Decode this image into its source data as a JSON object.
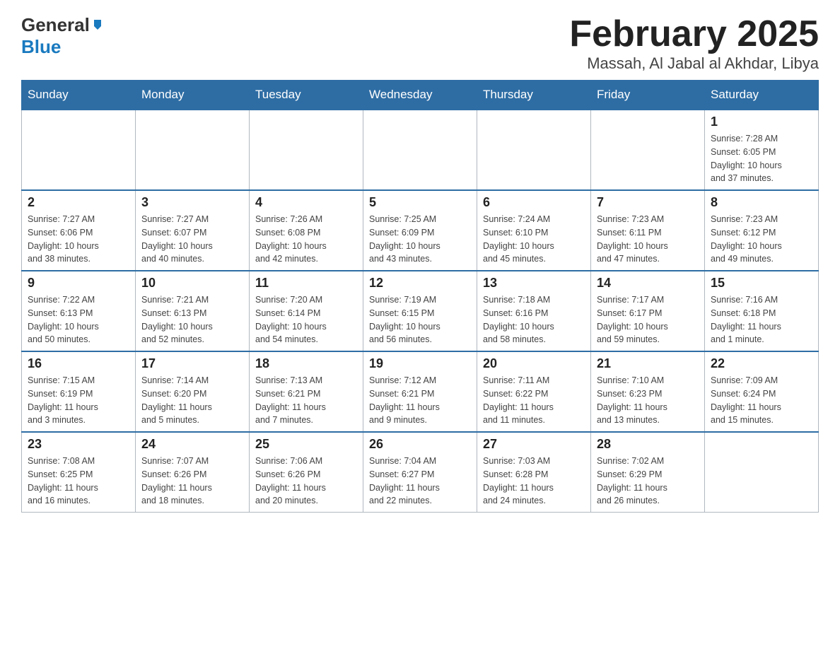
{
  "logo": {
    "general": "General",
    "blue": "Blue"
  },
  "title": "February 2025",
  "subtitle": "Massah, Al Jabal al Akhdar, Libya",
  "weekdays": [
    "Sunday",
    "Monday",
    "Tuesday",
    "Wednesday",
    "Thursday",
    "Friday",
    "Saturday"
  ],
  "weeks": [
    [
      {
        "day": "",
        "info": ""
      },
      {
        "day": "",
        "info": ""
      },
      {
        "day": "",
        "info": ""
      },
      {
        "day": "",
        "info": ""
      },
      {
        "day": "",
        "info": ""
      },
      {
        "day": "",
        "info": ""
      },
      {
        "day": "1",
        "info": "Sunrise: 7:28 AM\nSunset: 6:05 PM\nDaylight: 10 hours\nand 37 minutes."
      }
    ],
    [
      {
        "day": "2",
        "info": "Sunrise: 7:27 AM\nSunset: 6:06 PM\nDaylight: 10 hours\nand 38 minutes."
      },
      {
        "day": "3",
        "info": "Sunrise: 7:27 AM\nSunset: 6:07 PM\nDaylight: 10 hours\nand 40 minutes."
      },
      {
        "day": "4",
        "info": "Sunrise: 7:26 AM\nSunset: 6:08 PM\nDaylight: 10 hours\nand 42 minutes."
      },
      {
        "day": "5",
        "info": "Sunrise: 7:25 AM\nSunset: 6:09 PM\nDaylight: 10 hours\nand 43 minutes."
      },
      {
        "day": "6",
        "info": "Sunrise: 7:24 AM\nSunset: 6:10 PM\nDaylight: 10 hours\nand 45 minutes."
      },
      {
        "day": "7",
        "info": "Sunrise: 7:23 AM\nSunset: 6:11 PM\nDaylight: 10 hours\nand 47 minutes."
      },
      {
        "day": "8",
        "info": "Sunrise: 7:23 AM\nSunset: 6:12 PM\nDaylight: 10 hours\nand 49 minutes."
      }
    ],
    [
      {
        "day": "9",
        "info": "Sunrise: 7:22 AM\nSunset: 6:13 PM\nDaylight: 10 hours\nand 50 minutes."
      },
      {
        "day": "10",
        "info": "Sunrise: 7:21 AM\nSunset: 6:13 PM\nDaylight: 10 hours\nand 52 minutes."
      },
      {
        "day": "11",
        "info": "Sunrise: 7:20 AM\nSunset: 6:14 PM\nDaylight: 10 hours\nand 54 minutes."
      },
      {
        "day": "12",
        "info": "Sunrise: 7:19 AM\nSunset: 6:15 PM\nDaylight: 10 hours\nand 56 minutes."
      },
      {
        "day": "13",
        "info": "Sunrise: 7:18 AM\nSunset: 6:16 PM\nDaylight: 10 hours\nand 58 minutes."
      },
      {
        "day": "14",
        "info": "Sunrise: 7:17 AM\nSunset: 6:17 PM\nDaylight: 10 hours\nand 59 minutes."
      },
      {
        "day": "15",
        "info": "Sunrise: 7:16 AM\nSunset: 6:18 PM\nDaylight: 11 hours\nand 1 minute."
      }
    ],
    [
      {
        "day": "16",
        "info": "Sunrise: 7:15 AM\nSunset: 6:19 PM\nDaylight: 11 hours\nand 3 minutes."
      },
      {
        "day": "17",
        "info": "Sunrise: 7:14 AM\nSunset: 6:20 PM\nDaylight: 11 hours\nand 5 minutes."
      },
      {
        "day": "18",
        "info": "Sunrise: 7:13 AM\nSunset: 6:21 PM\nDaylight: 11 hours\nand 7 minutes."
      },
      {
        "day": "19",
        "info": "Sunrise: 7:12 AM\nSunset: 6:21 PM\nDaylight: 11 hours\nand 9 minutes."
      },
      {
        "day": "20",
        "info": "Sunrise: 7:11 AM\nSunset: 6:22 PM\nDaylight: 11 hours\nand 11 minutes."
      },
      {
        "day": "21",
        "info": "Sunrise: 7:10 AM\nSunset: 6:23 PM\nDaylight: 11 hours\nand 13 minutes."
      },
      {
        "day": "22",
        "info": "Sunrise: 7:09 AM\nSunset: 6:24 PM\nDaylight: 11 hours\nand 15 minutes."
      }
    ],
    [
      {
        "day": "23",
        "info": "Sunrise: 7:08 AM\nSunset: 6:25 PM\nDaylight: 11 hours\nand 16 minutes."
      },
      {
        "day": "24",
        "info": "Sunrise: 7:07 AM\nSunset: 6:26 PM\nDaylight: 11 hours\nand 18 minutes."
      },
      {
        "day": "25",
        "info": "Sunrise: 7:06 AM\nSunset: 6:26 PM\nDaylight: 11 hours\nand 20 minutes."
      },
      {
        "day": "26",
        "info": "Sunrise: 7:04 AM\nSunset: 6:27 PM\nDaylight: 11 hours\nand 22 minutes."
      },
      {
        "day": "27",
        "info": "Sunrise: 7:03 AM\nSunset: 6:28 PM\nDaylight: 11 hours\nand 24 minutes."
      },
      {
        "day": "28",
        "info": "Sunrise: 7:02 AM\nSunset: 6:29 PM\nDaylight: 11 hours\nand 26 minutes."
      },
      {
        "day": "",
        "info": ""
      }
    ]
  ]
}
